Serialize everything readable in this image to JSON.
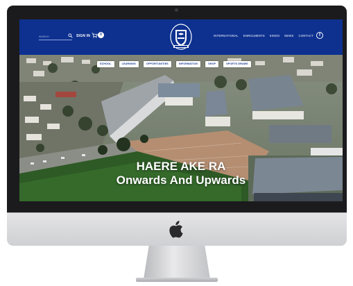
{
  "header": {
    "search_placeholder": "SEARCH",
    "sign_in_label": "SIGN IN",
    "cart_count": "0",
    "brand_color": "#0e3190"
  },
  "top_nav": {
    "items": [
      {
        "label": "INTERNATIONAL"
      },
      {
        "label": "ENROLMENTS"
      },
      {
        "label": "KINDO"
      },
      {
        "label": "NEWS"
      },
      {
        "label": "CONTACT"
      }
    ],
    "social_icon": "facebook-icon"
  },
  "sub_nav": {
    "items": [
      {
        "label": "SCHOOL"
      },
      {
        "label": "LEARNING"
      },
      {
        "label": "OPPORTUNITIES"
      },
      {
        "label": "INFORMATION"
      },
      {
        "label": "SHOP"
      },
      {
        "label": "SPORTS DRAWS"
      }
    ]
  },
  "hero": {
    "title": "HAERE AKE RA",
    "subtitle": "Onwards And Upwards"
  }
}
